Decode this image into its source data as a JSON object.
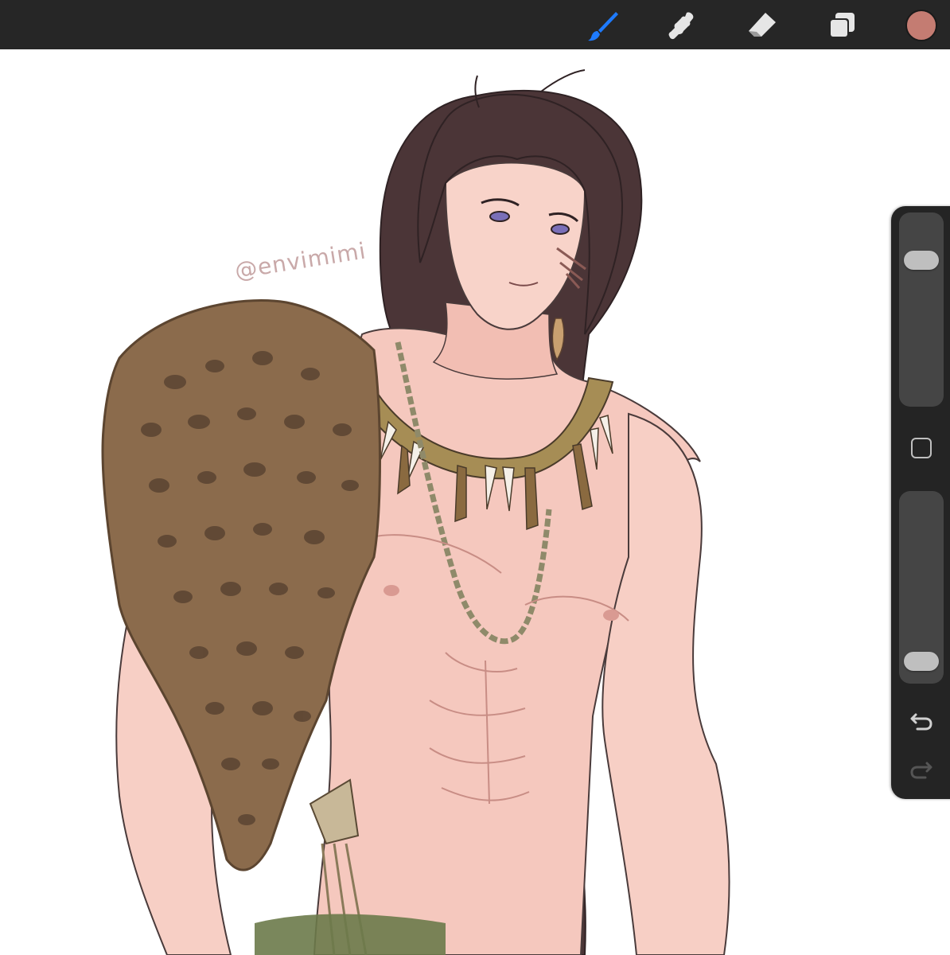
{
  "toolbar": {
    "tools": [
      {
        "name": "brush-icon",
        "active": true
      },
      {
        "name": "smudge-icon",
        "active": false
      },
      {
        "name": "eraser-icon",
        "active": false
      },
      {
        "name": "layers-icon",
        "active": false
      }
    ],
    "current_color": "#c47c72",
    "active_tool_color": "#1e7bff",
    "icon_color": "#e6e6e6"
  },
  "canvas": {
    "watermark": "@envimimi",
    "watermark_color": "#c9a9a9"
  },
  "sidebar": {
    "brush_size_level": 0.8,
    "opacity_level": 0.05,
    "modify_button_icon": "square-icon",
    "undo_icon": "undo-icon",
    "redo_icon": "redo-icon",
    "redo_enabled": false
  }
}
